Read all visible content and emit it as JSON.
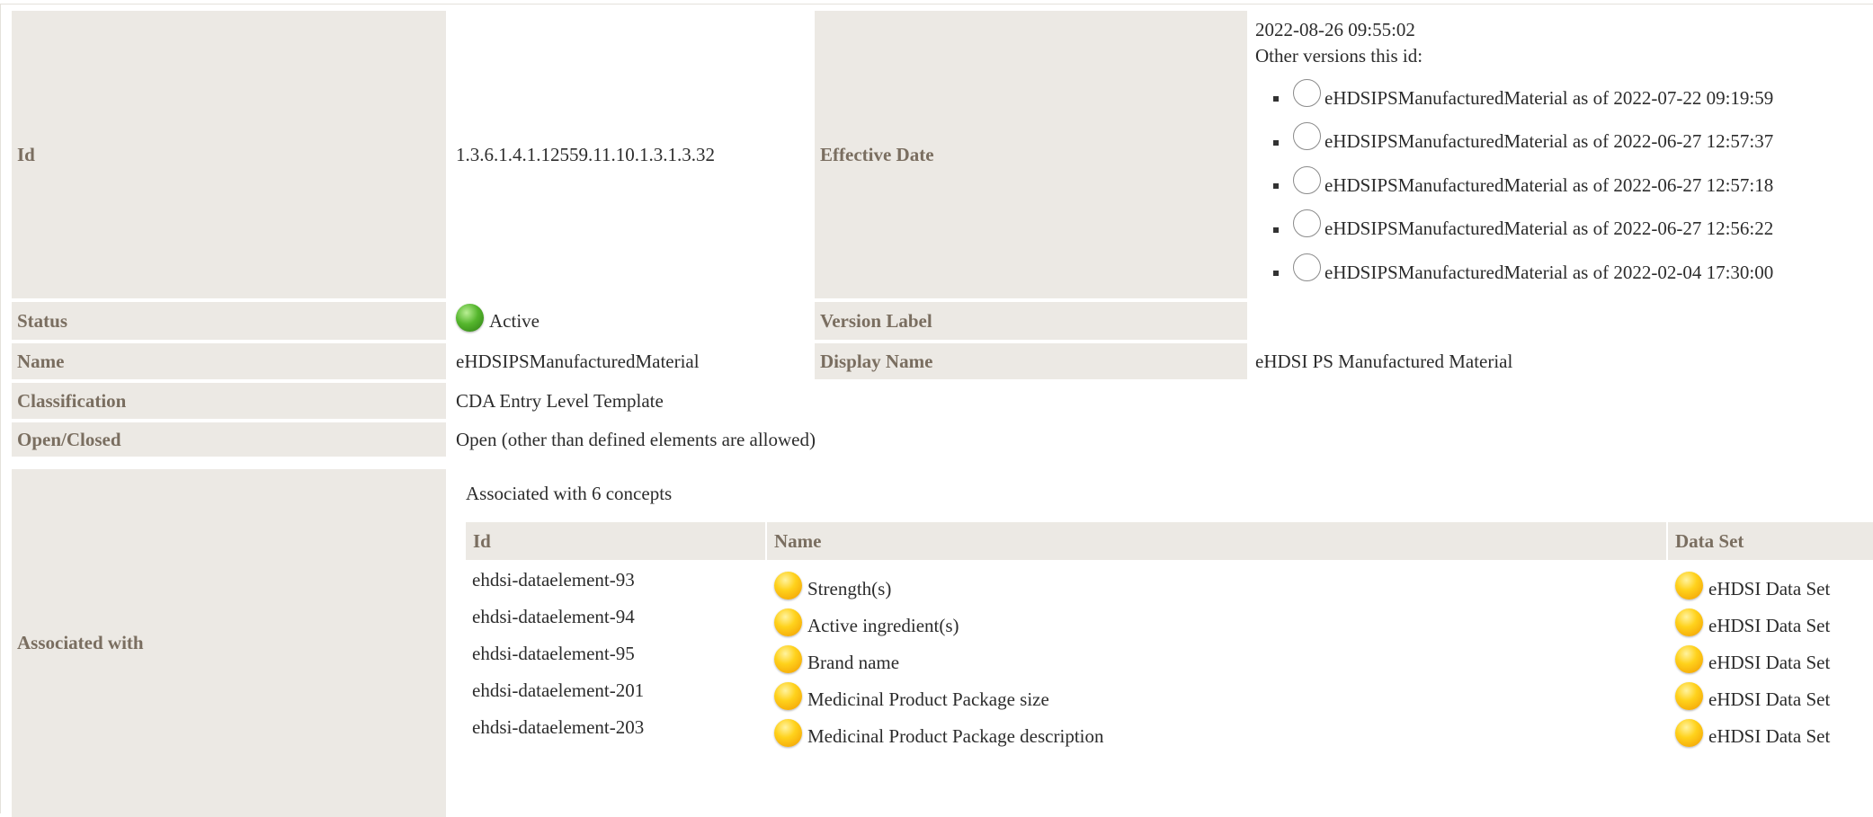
{
  "fields": {
    "id_label": "Id",
    "id_value": "1.3.6.1.4.1.12559.11.10.1.3.1.3.32",
    "effective_date_label": "Effective Date",
    "effective_date_value": "2022-08-26 09:55:02",
    "other_versions_label": "Other versions this id:",
    "status_label": "Status",
    "status_value": "Active",
    "version_label_label": "Version Label",
    "version_label_value": "",
    "name_label": "Name",
    "name_value": "eHDSIPSManufacturedMaterial",
    "display_name_label": "Display Name",
    "display_name_value": "eHDSI PS Manufactured Material",
    "classification_label": "Classification",
    "classification_value": "CDA Entry Level Template",
    "open_closed_label": "Open/Closed",
    "open_closed_value": "Open (other than defined elements are allowed)",
    "associated_label": "Associated with"
  },
  "versions": [
    "eHDSIPSManufacturedMaterial as of 2022-07-22 09:19:59",
    "eHDSIPSManufacturedMaterial as of 2022-06-27 12:57:37",
    "eHDSIPSManufacturedMaterial as of 2022-06-27 12:57:18",
    "eHDSIPSManufacturedMaterial as of 2022-06-27 12:56:22",
    "eHDSIPSManufacturedMaterial as of 2022-02-04 17:30:00"
  ],
  "associations": {
    "summary": "Associated with 6 concepts",
    "columns": [
      "Id",
      "Name",
      "Data Set"
    ],
    "rows": [
      {
        "id": "ehdsi-dataelement-93",
        "name": "Strength(s)",
        "dataset": "eHDSI Data Set"
      },
      {
        "id": "ehdsi-dataelement-94",
        "name": "Active ingredient(s)",
        "dataset": "eHDSI Data Set"
      },
      {
        "id": "ehdsi-dataelement-95",
        "name": "Brand name",
        "dataset": "eHDSI Data Set"
      },
      {
        "id": "ehdsi-dataelement-201",
        "name": "Medicinal Product Package size",
        "dataset": "eHDSI Data Set"
      },
      {
        "id": "ehdsi-dataelement-203",
        "name": "Medicinal Product Package description",
        "dataset": "eHDSI Data Set"
      }
    ]
  },
  "colors": {
    "label_bg": "#ece9e4",
    "label_text": "#7a6e60",
    "status_active": "#55b62d",
    "concept_status": "#ffd21c"
  },
  "icons": {
    "status": "green-status-dot-icon",
    "version": "radio-button-icon",
    "concept": "yellow-status-dot-icon"
  }
}
